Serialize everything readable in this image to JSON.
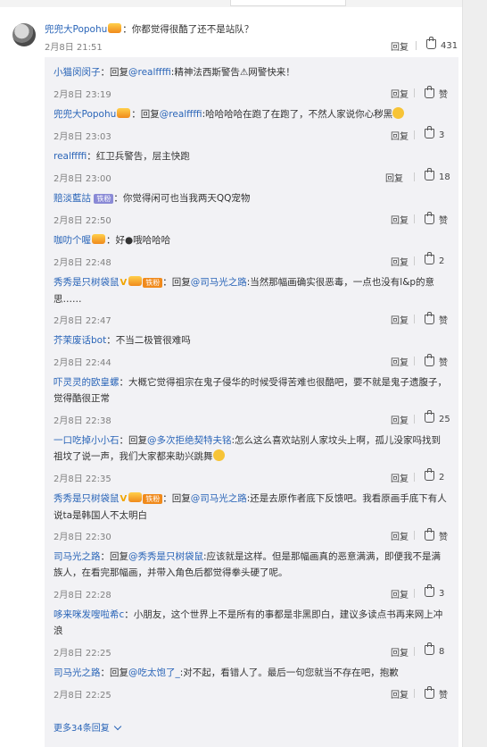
{
  "top_comment": {
    "user": "兜兜大Popohu",
    "text": "：你都觉得很酷了还不是站队？",
    "time": "2月8日 21:51",
    "reply_label": "回复",
    "likes": "431"
  },
  "replies": [
    {
      "user": "小猫闵闵子",
      "prefix": "：回复",
      "mention": "@realffffi",
      "body": ":精神法西斯警告⚠网警快来！",
      "time": "2月8日 23:19",
      "reply_label": "回复",
      "likes": "赞",
      "badge": "none"
    },
    {
      "user": "兜兜大Popohu",
      "prefix": "：回复",
      "mention": "@realffffi",
      "body": ":哈哈哈哈在跑了在跑了，不然人家说你心秽黑",
      "time": "2月8日 23:03",
      "reply_label": "回复",
      "likes": "3",
      "badge": "gold"
    },
    {
      "user": "realffffi",
      "prefix": "：红卫兵警告，层主快跑",
      "mention": "",
      "body": "",
      "time": "2月8日 23:00",
      "reply_label": "回复",
      "likes": "18",
      "badge": "none"
    },
    {
      "user": "赔淡藍詁",
      "prefix": "：你觉得闲可也当我两天QQ宠物",
      "mention": "",
      "body": "",
      "time": "2月8日 22:50",
      "reply_label": "回复",
      "likes": "赞",
      "badge": "purple",
      "badge_text": "铁粉"
    },
    {
      "user": "咖叻个喔",
      "prefix": "：好",
      "mention": "",
      "body": "哦哈哈哈",
      "time": "2月8日 22:48",
      "reply_label": "回复",
      "likes": "2",
      "badge": "gold"
    },
    {
      "user": "秀秀是只树袋鼠",
      "prefix": "：回复",
      "mention": "@司马光之路",
      "body": ":当然那幅画确实很恶毒，一点也没有l&p的意思……",
      "time": "2月8日 22:47",
      "reply_label": "回复",
      "likes": "赞",
      "badge": "v-orange",
      "badge_text": "铁粉"
    },
    {
      "user": "芥茉废话bot",
      "prefix": "：不当二极管很难吗",
      "mention": "",
      "body": "",
      "time": "2月8日 22:44",
      "reply_label": "回复",
      "likes": "赞",
      "badge": "none"
    },
    {
      "user": "吓灵灵的欧皇螺",
      "prefix": "：大概它觉得祖宗在鬼子侵华的时候受得苦难也很酷吧，要不就是鬼子遗腹子，觉得酷很正常",
      "mention": "",
      "body": "",
      "time": "2月8日 22:38",
      "reply_label": "回复",
      "likes": "25",
      "badge": "none"
    },
    {
      "user": "一口吃掉小小石",
      "prefix": "：回复",
      "mention": "@多次拒绝契特夫铭",
      "body": ":怎么这么喜欢站别人家坟头上啊，孤儿没家吗找到祖坟了说一声，我们大家都来助兴跳舞",
      "time": "2月8日 22:35",
      "reply_label": "回复",
      "likes": "2",
      "badge": "none"
    },
    {
      "user": "秀秀是只树袋鼠",
      "prefix": "：回复",
      "mention": "@司马光之路",
      "body": ":还是去原作者底下反馈吧。我看原画手底下有人说ta是韩国人不太明白",
      "time": "2月8日 22:30",
      "reply_label": "回复",
      "likes": "赞",
      "badge": "v-orange",
      "badge_text": "铁粉"
    },
    {
      "user": "司马光之路",
      "prefix": "：回复",
      "mention": "@秀秀是只树袋鼠",
      "body": ":应该就是这样。但是那幅画真的恶意满满，即便我不是满族人，在看完那幅画，并带入角色后都觉得拳头硬了呢。",
      "time": "2月8日 22:28",
      "reply_label": "回复",
      "likes": "3",
      "badge": "none"
    },
    {
      "user": "哆来咪发嗖啦希c",
      "prefix": "：小朋友，这个世界上不是所有的事都是非黑即白，建议多读点书再来网上冲浪",
      "mention": "",
      "body": "",
      "time": "2月8日 22:25",
      "reply_label": "回复",
      "likes": "8",
      "badge": "none"
    },
    {
      "user": "司马光之路",
      "prefix": "：回复",
      "mention": "@吃太饱了_",
      "body": ":对不起，看错人了。最后一句您就当不存在吧，抱歉",
      "time": "2月8日 22:25",
      "reply_label": "回复",
      "likes": "赞",
      "badge": "none"
    }
  ],
  "more_replies": "更多34条回复"
}
